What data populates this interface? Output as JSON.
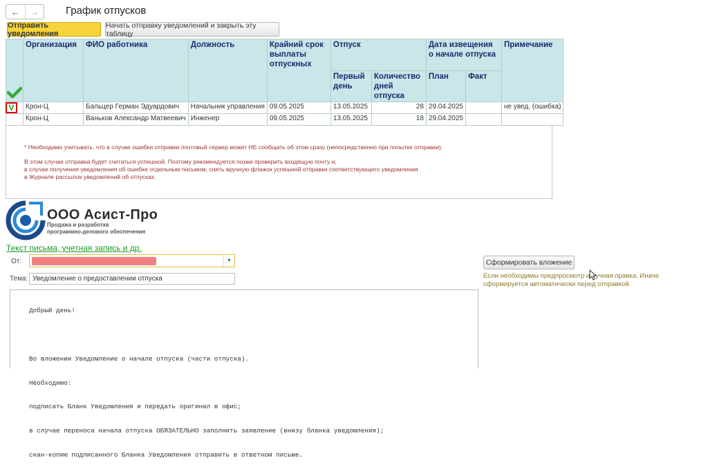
{
  "window": {
    "title": "График отпусков"
  },
  "nav": {
    "back_label": "←",
    "forward_label": "→"
  },
  "toolbar": {
    "send_label": "Отправить уведомления",
    "start_close_label": "Начать отправку уведомлений и закрыть эту таблицу"
  },
  "table": {
    "headers": {
      "org": "Организация",
      "fio": "ФИО работника",
      "position": "Должность",
      "deadline": "Крайний срок выплаты отпускных",
      "vacation": "Отпуск",
      "first_day": "Первый день",
      "days_count": "Количество дней отпуска",
      "notify_date": "Дата извещения о начале отпуска",
      "plan": "План",
      "fact": "Факт",
      "note": "Примечание"
    },
    "rows": [
      {
        "check": "V",
        "org": "Крон-Ц",
        "fio": "Бальцер Герман Эдуардович",
        "position": "Начальник управления",
        "deadline": "09.05.2025",
        "first_day": "13.05.2025",
        "days": "28",
        "plan": "29.04.2025",
        "fact": "",
        "note": "не увед. (ошибка)"
      },
      {
        "check": "",
        "org": "Крон-Ц",
        "fio": "Ваньков Александр Матвеевич",
        "position": "Инженер",
        "deadline": "09.05.2025",
        "first_day": "13.05.2025",
        "days": "18",
        "plan": "29.04.2025",
        "fact": "",
        "note": ""
      }
    ]
  },
  "notes": {
    "line1": "* Необходимо учитывать, что в случае ошибки отправки почтовый сервер может НЕ сообщать об этом сразу (непосредственно при попытке отправки).",
    "line2": "В этом случае отправка будет считаться успешной. Поэтому рекомендуется позже проверить входящую почту и,",
    "line3": "в случае получения уведомления об ошибке отдельным письмом, снять вручную флажок успешной отправки соответствующего уведомления",
    "line4": "в Журнале рассылок уведомлений об отпусках."
  },
  "logo": {
    "name": "ООО Асист-Про",
    "sub1": "Продажа и разработка",
    "sub2": "программно-делового обеспечения"
  },
  "form": {
    "link": "Текст письма, учетная запись и др.",
    "from_label": "От:",
    "subject_label": "Тема:",
    "subject_value": "Уведомление о предоставлении отпуска",
    "attach_button": "Сформировать вложение",
    "hint": "Если необходимы предпросмотр и ручная правка. Иначе сформируется автоматически перед отправкой.",
    "body_lines": [
      "Добрый день!",
      "",
      "Во вложении Уведомление о начале отпуска (части отпуска).",
      "Необходимо:",
      "подписать Бланк Уведомления и передать оригинал в офис;",
      "в случае переноса начала отпуска ОБЯЗАТЕЛЬНО заполнить заявление (внизу бланка уведомления);",
      "скан-копию подписанного Бланка Уведомления отправить в ответном письме."
    ]
  },
  "colors": {
    "accent_yellow": "#f6d43a",
    "header_bg": "#c9e7e9",
    "check_green": "#1e9a1e",
    "error_red": "#e00000",
    "note_red": "#9a3030",
    "link_green": "#1a9a2a"
  }
}
